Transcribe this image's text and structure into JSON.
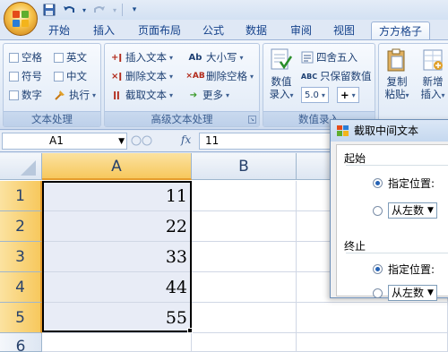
{
  "quick_access": {
    "icons": [
      "save-icon",
      "undo-icon",
      "redo-icon",
      "customize-icon"
    ]
  },
  "tabs": [
    {
      "label": "开始",
      "active": false
    },
    {
      "label": "插入",
      "active": false
    },
    {
      "label": "页面布局",
      "active": false
    },
    {
      "label": "公式",
      "active": false
    },
    {
      "label": "数据",
      "active": false
    },
    {
      "label": "审阅",
      "active": false
    },
    {
      "label": "视图",
      "active": false
    },
    {
      "label": "方方格子",
      "active": true
    }
  ],
  "ribbon": {
    "text_group": {
      "label": "文本处理",
      "items": {
        "space": "空格",
        "english": "英文",
        "symbol": "符号",
        "chinese": "中文",
        "number": "数字",
        "execute": "执行"
      }
    },
    "advanced_group": {
      "label": "高级文本处理",
      "items": {
        "insert_text": "插入文本",
        "delete_text": "删除文本",
        "extract_text": "截取文本",
        "case": "大小写",
        "delete_space": "删除空格",
        "more": "更多"
      }
    },
    "number_group": {
      "label": "数值录入",
      "items": {
        "number_entry_1": "数值",
        "number_entry_2": "录入",
        "round": "四舍五入",
        "keep_value": "只保留数值",
        "digits": "5.0",
        "plus": "+"
      }
    },
    "copy_group": {
      "copy_1": "复制",
      "copy_2": "粘贴",
      "add_1": "新增",
      "add_2": "插入"
    }
  },
  "formula_bar": {
    "name_box": "A1",
    "formula": "11",
    "fx_label": "fx"
  },
  "sheet": {
    "columns": [
      "A",
      "B"
    ],
    "rows": [
      "1",
      "2",
      "3",
      "4",
      "5",
      "6"
    ],
    "values": [
      "11",
      "22",
      "33",
      "44",
      "55",
      ""
    ]
  },
  "dialog": {
    "title": "截取中间文本",
    "start_label": "起始",
    "start_option_specified": "指定位置:",
    "start_option_from": "从左数",
    "end_label": "终止",
    "end_option_specified": "指定位置:",
    "end_option_from": "从左数"
  },
  "colors": {
    "ribbon_blue": "#dfe8f5",
    "selection_header": "#f7c85d",
    "selection_fill": "#e8ecf6"
  }
}
